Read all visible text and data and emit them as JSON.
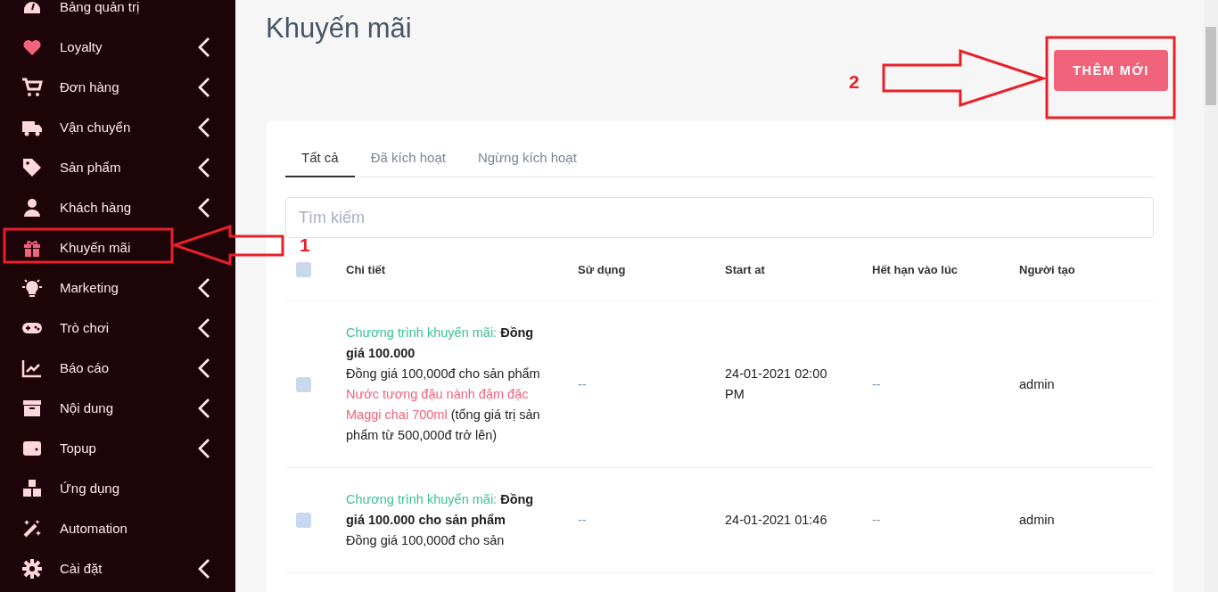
{
  "sidebar": {
    "items": [
      {
        "label": "Bảng quản trị",
        "has_submenu": false
      },
      {
        "label": "Loyalty",
        "has_submenu": true
      },
      {
        "label": "Đơn hàng",
        "has_submenu": true
      },
      {
        "label": "Vận chuyển",
        "has_submenu": true
      },
      {
        "label": "Sản phẩm",
        "has_submenu": true
      },
      {
        "label": "Khách hàng",
        "has_submenu": true
      },
      {
        "label": "Khuyến mãi",
        "has_submenu": false
      },
      {
        "label": "Marketing",
        "has_submenu": true
      },
      {
        "label": "Trò chơi",
        "has_submenu": true
      },
      {
        "label": "Báo cáo",
        "has_submenu": true
      },
      {
        "label": "Nội dung",
        "has_submenu": true
      },
      {
        "label": "Topup",
        "has_submenu": true
      },
      {
        "label": "Ứng dụng",
        "has_submenu": false
      },
      {
        "label": "Automation",
        "has_submenu": false
      },
      {
        "label": "Cài đặt",
        "has_submenu": true
      }
    ]
  },
  "page": {
    "title": "Khuyến mãi",
    "add_button": "THÊM MỚI"
  },
  "tabs": [
    {
      "label": "Tất cả",
      "selected": true
    },
    {
      "label": "Đã kích hoạt",
      "selected": false
    },
    {
      "label": "Ngừng kích hoạt",
      "selected": false
    }
  ],
  "search": {
    "placeholder": "Tìm kiếm"
  },
  "table": {
    "select_all_checked": false,
    "columns": [
      "Chi tiết",
      "Sử dụng",
      "Start at",
      "Hết hạn vào lúc",
      "Người tạo"
    ],
    "rows": [
      {
        "checked": false,
        "program_label": "Chương trình khuyến mãi:",
        "title": "Đồng giá 100.000",
        "description": "Đồng giá 100,000đ cho sản phẩm ",
        "product": "Nước tương đậu nành đậm đặc Maggi chai 700ml",
        "note": " (tổng giá trị sản phẩm từ 500,000đ trở lên)",
        "usage": "--",
        "start_at": "24-01-2021 02:00 PM",
        "expires_at": "--",
        "creator": "admin"
      },
      {
        "checked": false,
        "program_label": "Chương trình khuyến mãi:",
        "title": "Đồng giá 100.000 cho sản phẩm",
        "description": "Đồng giá 100,000đ cho sản",
        "start_at": "24-01-2021 01:46",
        "usage": "--",
        "expires_at": "--",
        "creator": "admin"
      }
    ]
  },
  "annotations": [
    {
      "number": "1"
    },
    {
      "number": "2"
    }
  ]
}
